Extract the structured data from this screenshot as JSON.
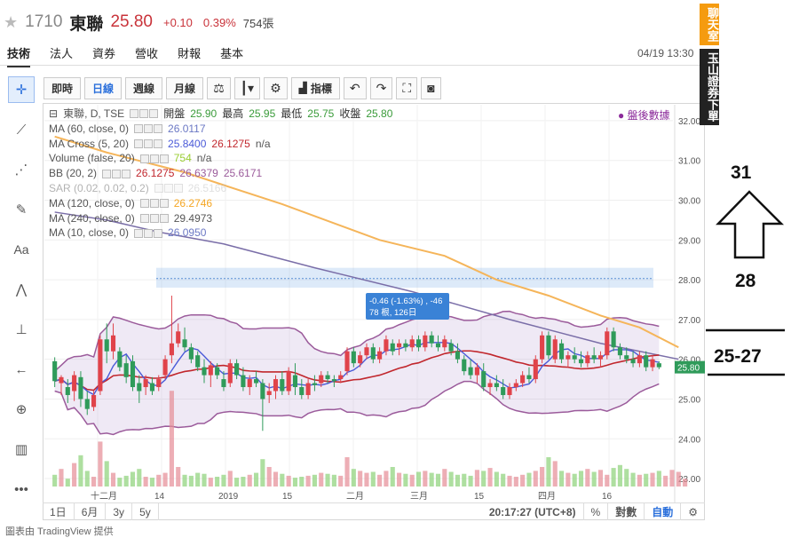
{
  "header": {
    "code": "1710",
    "name": "東聯",
    "price": "25.80",
    "change": "+0.10",
    "change_pct": "0.39%",
    "volume": "754張"
  },
  "tabs": [
    {
      "label": "技術",
      "active": true
    },
    {
      "label": "法人"
    },
    {
      "label": "資券"
    },
    {
      "label": "營收"
    },
    {
      "label": "財報"
    },
    {
      "label": "基本"
    }
  ],
  "datetime": "04/19 13:30",
  "toolbar": {
    "buttons": [
      "即時",
      "日線",
      "週線",
      "月線"
    ],
    "active": "日線",
    "indicator_label": "指標"
  },
  "legend": {
    "main": {
      "label": "東聯, D, TSE",
      "open_label": "開盤",
      "open": "25.90",
      "high_label": "最高",
      "high": "25.95",
      "low_label": "最低",
      "low": "25.75",
      "close_label": "收盤",
      "close": "25.80"
    },
    "indicators": [
      {
        "label": "MA (60, close, 0)",
        "values": [
          "26.0117"
        ],
        "colors": [
          "#6b78c4"
        ]
      },
      {
        "label": "MA Cross (5, 20)",
        "values": [
          "25.8400",
          "26.1275",
          "n/a"
        ],
        "colors": [
          "#4a5ad8",
          "#c1272d",
          "#555"
        ]
      },
      {
        "label": "Volume (false, 20)",
        "values": [
          "754",
          "n/a"
        ],
        "colors": [
          "#9acd32",
          "#555"
        ]
      },
      {
        "label": "BB (20, 2)",
        "values": [
          "26.1275",
          "26.6379",
          "25.6171"
        ],
        "colors": [
          "#c1272d",
          "#9b5b9b",
          "#9b5b9b"
        ]
      },
      {
        "label": "SAR (0.02, 0.02, 0.2)",
        "values": [
          "26.5166"
        ],
        "colors": [
          "#bbb"
        ],
        "faded": true
      },
      {
        "label": "MA (120, close, 0)",
        "values": [
          "26.2746"
        ],
        "colors": [
          "#f5a623"
        ]
      },
      {
        "label": "MA (240, close, 0)",
        "values": [
          "29.4973"
        ],
        "colors": [
          "#555"
        ]
      },
      {
        "label": "MA (10, close, 0)",
        "values": [
          "26.0950"
        ],
        "colors": [
          "#6b78c4"
        ]
      }
    ]
  },
  "after_hours_label": "盤後數據",
  "tooltip": {
    "line1": "-0.46 (-1.63%) , -46",
    "line2": "78 根, 126日"
  },
  "bottom_bar": {
    "ranges": [
      "1日",
      "6月",
      "3y",
      "5y"
    ],
    "clock": "20:17:27 (UTC+8)",
    "pct": "%",
    "log": "對數",
    "auto": "自動"
  },
  "right_tabs": [
    "聊天室",
    "玉山證券下單"
  ],
  "annotations": {
    "target": "31",
    "level": "28",
    "range": "25-27"
  },
  "footer": "圖表由 TradingView 提供",
  "chart_data": {
    "type": "candlestick",
    "ylim": [
      22.8,
      32.4
    ],
    "yticks": [
      "32.00",
      "31.00",
      "30.00",
      "29.00",
      "28.00",
      "27.00",
      "26.00",
      "25.00",
      "24.00",
      "23.00"
    ],
    "last_price_tag": "25.80",
    "xticks": [
      "十二月",
      "14",
      "2019",
      "15",
      "二月",
      "三月",
      "15",
      "四月",
      "16"
    ],
    "candles": [
      {
        "o": 25.95,
        "h": 26.05,
        "l": 25.3,
        "c": 25.45
      },
      {
        "o": 25.4,
        "h": 25.6,
        "l": 25.1,
        "c": 25.55
      },
      {
        "o": 25.3,
        "h": 25.5,
        "l": 24.9,
        "c": 25.1
      },
      {
        "o": 25.2,
        "h": 25.7,
        "l": 24.95,
        "c": 25.6
      },
      {
        "o": 25.55,
        "h": 25.7,
        "l": 24.8,
        "c": 25.0
      },
      {
        "o": 25.0,
        "h": 25.2,
        "l": 24.6,
        "c": 24.75
      },
      {
        "o": 24.8,
        "h": 25.2,
        "l": 24.7,
        "c": 25.1
      },
      {
        "o": 25.2,
        "h": 26.6,
        "l": 25.1,
        "c": 26.5
      },
      {
        "o": 26.5,
        "h": 26.9,
        "l": 25.9,
        "c": 26.2
      },
      {
        "o": 26.2,
        "h": 26.9,
        "l": 26.0,
        "c": 26.6
      },
      {
        "o": 26.2,
        "h": 26.3,
        "l": 25.7,
        "c": 25.8
      },
      {
        "o": 25.9,
        "h": 26.1,
        "l": 25.4,
        "c": 25.55
      },
      {
        "o": 25.95,
        "h": 26.1,
        "l": 25.2,
        "c": 25.3
      },
      {
        "o": 25.4,
        "h": 25.6,
        "l": 24.9,
        "c": 25.2
      },
      {
        "o": 25.3,
        "h": 25.6,
        "l": 25.1,
        "c": 25.5
      },
      {
        "o": 25.4,
        "h": 25.55,
        "l": 25.1,
        "c": 25.2
      },
      {
        "o": 25.3,
        "h": 25.6,
        "l": 25.2,
        "c": 25.5
      },
      {
        "o": 25.6,
        "h": 26.1,
        "l": 25.5,
        "c": 26.0
      },
      {
        "o": 26.1,
        "h": 27.6,
        "l": 25.9,
        "c": 26.4
      },
      {
        "o": 26.4,
        "h": 26.9,
        "l": 26.3,
        "c": 26.7
      },
      {
        "o": 26.5,
        "h": 26.8,
        "l": 26.2,
        "c": 26.3
      },
      {
        "o": 26.3,
        "h": 26.4,
        "l": 25.9,
        "c": 26.0
      },
      {
        "o": 26.1,
        "h": 26.2,
        "l": 25.7,
        "c": 25.8
      },
      {
        "o": 25.8,
        "h": 26.0,
        "l": 25.4,
        "c": 25.6
      },
      {
        "o": 25.6,
        "h": 25.95,
        "l": 25.3,
        "c": 25.85
      },
      {
        "o": 25.8,
        "h": 25.9,
        "l": 25.5,
        "c": 25.6
      },
      {
        "o": 25.5,
        "h": 25.7,
        "l": 25.2,
        "c": 25.3
      },
      {
        "o": 25.4,
        "h": 26.0,
        "l": 25.3,
        "c": 25.9
      },
      {
        "o": 25.9,
        "h": 26.0,
        "l": 25.5,
        "c": 25.6
      },
      {
        "o": 25.6,
        "h": 25.8,
        "l": 25.2,
        "c": 25.3
      },
      {
        "o": 25.3,
        "h": 25.6,
        "l": 25.1,
        "c": 25.5
      },
      {
        "o": 25.5,
        "h": 25.7,
        "l": 25.3,
        "c": 25.4
      },
      {
        "o": 25.4,
        "h": 25.5,
        "l": 24.2,
        "c": 25.0
      },
      {
        "o": 25.1,
        "h": 25.4,
        "l": 24.9,
        "c": 25.2
      },
      {
        "o": 25.2,
        "h": 25.6,
        "l": 25.0,
        "c": 25.5
      },
      {
        "o": 25.5,
        "h": 25.7,
        "l": 25.1,
        "c": 25.2
      },
      {
        "o": 25.2,
        "h": 25.8,
        "l": 25.1,
        "c": 25.7
      },
      {
        "o": 25.6,
        "h": 25.9,
        "l": 25.1,
        "c": 25.3
      },
      {
        "o": 25.3,
        "h": 25.5,
        "l": 25.0,
        "c": 25.1
      },
      {
        "o": 25.1,
        "h": 25.5,
        "l": 25.0,
        "c": 25.4
      },
      {
        "o": 25.4,
        "h": 25.6,
        "l": 25.2,
        "c": 25.35
      },
      {
        "o": 25.4,
        "h": 25.7,
        "l": 25.3,
        "c": 25.6
      },
      {
        "o": 25.6,
        "h": 25.7,
        "l": 25.4,
        "c": 25.5
      },
      {
        "o": 25.5,
        "h": 25.6,
        "l": 25.3,
        "c": 25.45
      },
      {
        "o": 25.5,
        "h": 25.7,
        "l": 25.4,
        "c": 25.6
      },
      {
        "o": 25.7,
        "h": 26.3,
        "l": 25.6,
        "c": 26.2
      },
      {
        "o": 26.2,
        "h": 26.3,
        "l": 25.8,
        "c": 25.9
      },
      {
        "o": 25.9,
        "h": 26.2,
        "l": 25.8,
        "c": 26.1
      },
      {
        "o": 26.1,
        "h": 26.4,
        "l": 26.0,
        "c": 26.3
      },
      {
        "o": 26.3,
        "h": 26.4,
        "l": 25.9,
        "c": 26.0
      },
      {
        "o": 26.0,
        "h": 26.3,
        "l": 25.9,
        "c": 26.2
      },
      {
        "o": 26.2,
        "h": 26.6,
        "l": 26.1,
        "c": 26.5
      },
      {
        "o": 26.4,
        "h": 26.5,
        "l": 26.1,
        "c": 26.2
      },
      {
        "o": 26.3,
        "h": 26.5,
        "l": 26.1,
        "c": 26.4
      },
      {
        "o": 26.4,
        "h": 26.5,
        "l": 26.2,
        "c": 26.3
      },
      {
        "o": 26.3,
        "h": 26.6,
        "l": 26.2,
        "c": 26.5
      },
      {
        "o": 26.5,
        "h": 26.6,
        "l": 26.2,
        "c": 26.3
      },
      {
        "o": 26.3,
        "h": 26.7,
        "l": 26.2,
        "c": 26.6
      },
      {
        "o": 26.6,
        "h": 26.7,
        "l": 26.3,
        "c": 26.4
      },
      {
        "o": 26.4,
        "h": 26.6,
        "l": 26.2,
        "c": 26.3
      },
      {
        "o": 26.3,
        "h": 26.6,
        "l": 26.2,
        "c": 26.5
      },
      {
        "o": 26.4,
        "h": 26.5,
        "l": 26.1,
        "c": 26.2
      },
      {
        "o": 26.2,
        "h": 26.4,
        "l": 25.9,
        "c": 26.0
      },
      {
        "o": 26.0,
        "h": 26.1,
        "l": 25.6,
        "c": 25.7
      },
      {
        "o": 25.8,
        "h": 26.0,
        "l": 25.5,
        "c": 25.6
      },
      {
        "o": 25.6,
        "h": 25.9,
        "l": 25.4,
        "c": 25.8
      },
      {
        "o": 25.7,
        "h": 25.9,
        "l": 25.2,
        "c": 25.3
      },
      {
        "o": 25.3,
        "h": 25.5,
        "l": 25.1,
        "c": 25.4
      },
      {
        "o": 25.4,
        "h": 25.6,
        "l": 25.2,
        "c": 25.3
      },
      {
        "o": 25.3,
        "h": 25.5,
        "l": 25.0,
        "c": 25.1
      },
      {
        "o": 25.1,
        "h": 25.4,
        "l": 25.0,
        "c": 25.3
      },
      {
        "o": 25.3,
        "h": 25.5,
        "l": 25.2,
        "c": 25.4
      },
      {
        "o": 25.4,
        "h": 25.7,
        "l": 25.3,
        "c": 25.6
      },
      {
        "o": 25.6,
        "h": 25.8,
        "l": 25.4,
        "c": 25.5
      },
      {
        "o": 25.5,
        "h": 26.1,
        "l": 25.4,
        "c": 26.0
      },
      {
        "o": 26.0,
        "h": 26.7,
        "l": 25.9,
        "c": 26.6
      },
      {
        "o": 26.6,
        "h": 26.7,
        "l": 26.0,
        "c": 26.1
      },
      {
        "o": 26.0,
        "h": 26.6,
        "l": 25.9,
        "c": 26.5
      },
      {
        "o": 26.4,
        "h": 26.5,
        "l": 25.9,
        "c": 26.0
      },
      {
        "o": 26.0,
        "h": 26.2,
        "l": 25.8,
        "c": 26.1
      },
      {
        "o": 26.1,
        "h": 26.3,
        "l": 25.9,
        "c": 26.0
      },
      {
        "o": 26.0,
        "h": 26.2,
        "l": 25.8,
        "c": 25.9
      },
      {
        "o": 25.9,
        "h": 26.2,
        "l": 25.8,
        "c": 26.1
      },
      {
        "o": 26.1,
        "h": 26.3,
        "l": 25.9,
        "c": 26.0
      },
      {
        "o": 26.0,
        "h": 26.2,
        "l": 25.8,
        "c": 26.1
      },
      {
        "o": 26.1,
        "h": 26.8,
        "l": 26.0,
        "c": 26.7
      },
      {
        "o": 26.7,
        "h": 26.8,
        "l": 26.2,
        "c": 26.3
      },
      {
        "o": 26.3,
        "h": 26.4,
        "l": 26.0,
        "c": 26.1
      },
      {
        "o": 26.1,
        "h": 26.3,
        "l": 25.9,
        "c": 26.0
      },
      {
        "o": 26.0,
        "h": 26.2,
        "l": 25.8,
        "c": 25.9
      },
      {
        "o": 25.9,
        "h": 26.2,
        "l": 25.8,
        "c": 26.1
      },
      {
        "o": 26.1,
        "h": 26.2,
        "l": 25.7,
        "c": 25.8
      },
      {
        "o": 25.8,
        "h": 26.1,
        "l": 25.7,
        "c": 26.0
      },
      {
        "o": 25.9,
        "h": 25.95,
        "l": 25.75,
        "c": 25.8
      }
    ],
    "ma120_path": [
      [
        0,
        31.6
      ],
      [
        8,
        31.2
      ],
      [
        20,
        30.7
      ],
      [
        35,
        29.9
      ],
      [
        50,
        29.0
      ],
      [
        60,
        28.6
      ],
      [
        68,
        28.0
      ],
      [
        76,
        27.6
      ],
      [
        84,
        27.1
      ],
      [
        90,
        26.8
      ],
      [
        96,
        26.3
      ]
    ],
    "ma240_path": [
      [
        0,
        29.7
      ],
      [
        8,
        29.5
      ],
      [
        16,
        29.2
      ],
      [
        26,
        28.9
      ],
      [
        40,
        28.3
      ],
      [
        55,
        27.7
      ],
      [
        70,
        27.0
      ],
      [
        84,
        26.4
      ],
      [
        96,
        26.0
      ]
    ],
    "volumes": [
      120,
      180,
      80,
      240,
      320,
      160,
      100,
      460,
      260,
      140,
      90,
      110,
      150,
      180,
      100,
      90,
      120,
      140,
      980,
      200,
      120,
      110,
      140,
      130,
      90,
      100,
      120,
      160,
      90,
      100,
      120,
      140,
      280,
      200,
      150,
      130,
      110,
      90,
      100,
      110,
      120,
      140,
      130,
      120,
      110,
      300,
      180,
      160,
      140,
      150,
      120,
      160,
      200,
      140,
      130,
      120,
      150,
      160,
      140,
      130,
      180,
      150,
      120,
      130,
      110,
      170,
      160,
      190,
      150,
      130,
      110,
      100,
      120,
      140,
      160,
      200,
      300,
      260,
      160,
      140,
      130,
      160,
      180,
      150,
      170,
      120,
      190,
      220,
      180,
      140,
      120,
      130,
      140,
      160,
      110,
      170,
      150,
      80
    ]
  }
}
